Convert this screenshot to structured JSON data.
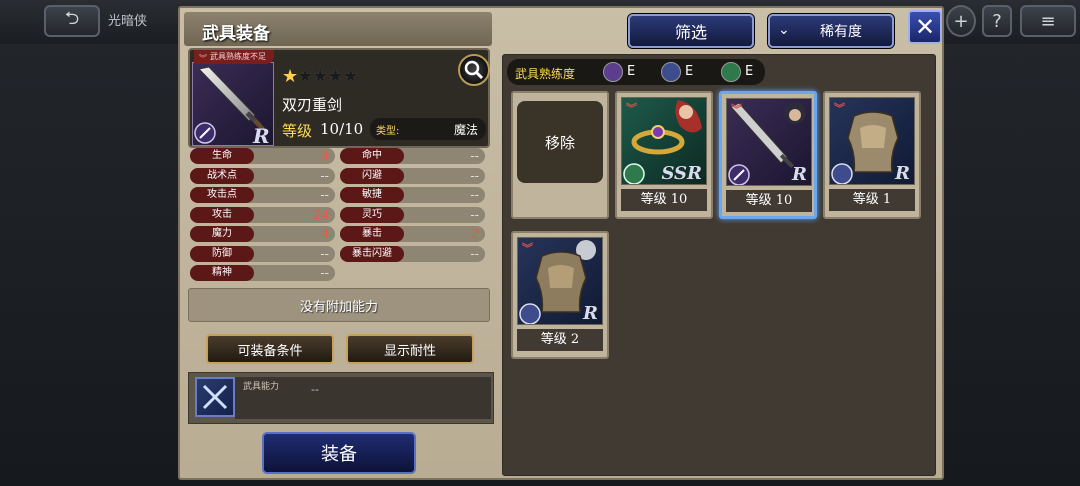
{
  "topbar": {
    "back_label": "⮌",
    "title_label": "光暗侠",
    "plus_label": "+",
    "help_label": "?",
    "menu_label": "≡"
  },
  "panel": {
    "title": "武具装备",
    "filter_label": "筛选",
    "sort_label": "稀有度",
    "close_label": "✕"
  },
  "weapon": {
    "warning": "武具熟练度不足",
    "name": "双刃重剑",
    "level_label": "等级",
    "level_value": "10/10",
    "type_label": "类型:",
    "type_value": "魔法",
    "stars_filled": 1,
    "stars_total": 5,
    "rarity": "R"
  },
  "stats_left": [
    {
      "name": "生命",
      "value": "4",
      "highlight": true
    },
    {
      "name": "战术点",
      "value": "--",
      "highlight": false
    },
    {
      "name": "攻击点",
      "value": "--",
      "highlight": false
    },
    {
      "name": "攻击",
      "value": "24",
      "highlight": true
    },
    {
      "name": "魔力",
      "value": "4",
      "highlight": true
    },
    {
      "name": "防御",
      "value": "--",
      "highlight": false
    },
    {
      "name": "精神",
      "value": "--",
      "highlight": false
    }
  ],
  "stats_right": [
    {
      "name": "命中",
      "value": "--",
      "highlight": false
    },
    {
      "name": "闪避",
      "value": "--",
      "highlight": false
    },
    {
      "name": "敏捷",
      "value": "--",
      "highlight": false
    },
    {
      "name": "灵巧",
      "value": "--",
      "highlight": false
    },
    {
      "name": "暴击",
      "value": "2",
      "highlight": true
    },
    {
      "name": "暴击闪避",
      "value": "--",
      "highlight": false
    }
  ],
  "extra_ability": "没有附加能力",
  "buttons": {
    "conditions": "可装备条件",
    "resist": "显示耐性",
    "equip": "装备"
  },
  "ability": {
    "label": "武具能力",
    "value": "--"
  },
  "proficiency": {
    "title": "武具熟练度",
    "items": [
      {
        "icon": "sword-icon",
        "grade": "E",
        "color": "#5b3f8e"
      },
      {
        "icon": "magic-icon",
        "grade": "E",
        "color": "#3d4c8c"
      },
      {
        "icon": "shield-icon",
        "grade": "E",
        "color": "#2f7a4a"
      }
    ]
  },
  "cards": [
    {
      "type": "remove",
      "label": "移除"
    },
    {
      "type": "item",
      "level": "等级 10",
      "rarity": "SSR",
      "art": "ring",
      "selected": false
    },
    {
      "type": "item",
      "level": "等级 10",
      "rarity": "R",
      "art": "sword",
      "selected": true
    },
    {
      "type": "item",
      "level": "等级 1",
      "rarity": "R",
      "art": "armor",
      "selected": false
    },
    {
      "type": "item",
      "level": "等级 2",
      "rarity": "R",
      "art": "armor2",
      "selected": false
    }
  ]
}
